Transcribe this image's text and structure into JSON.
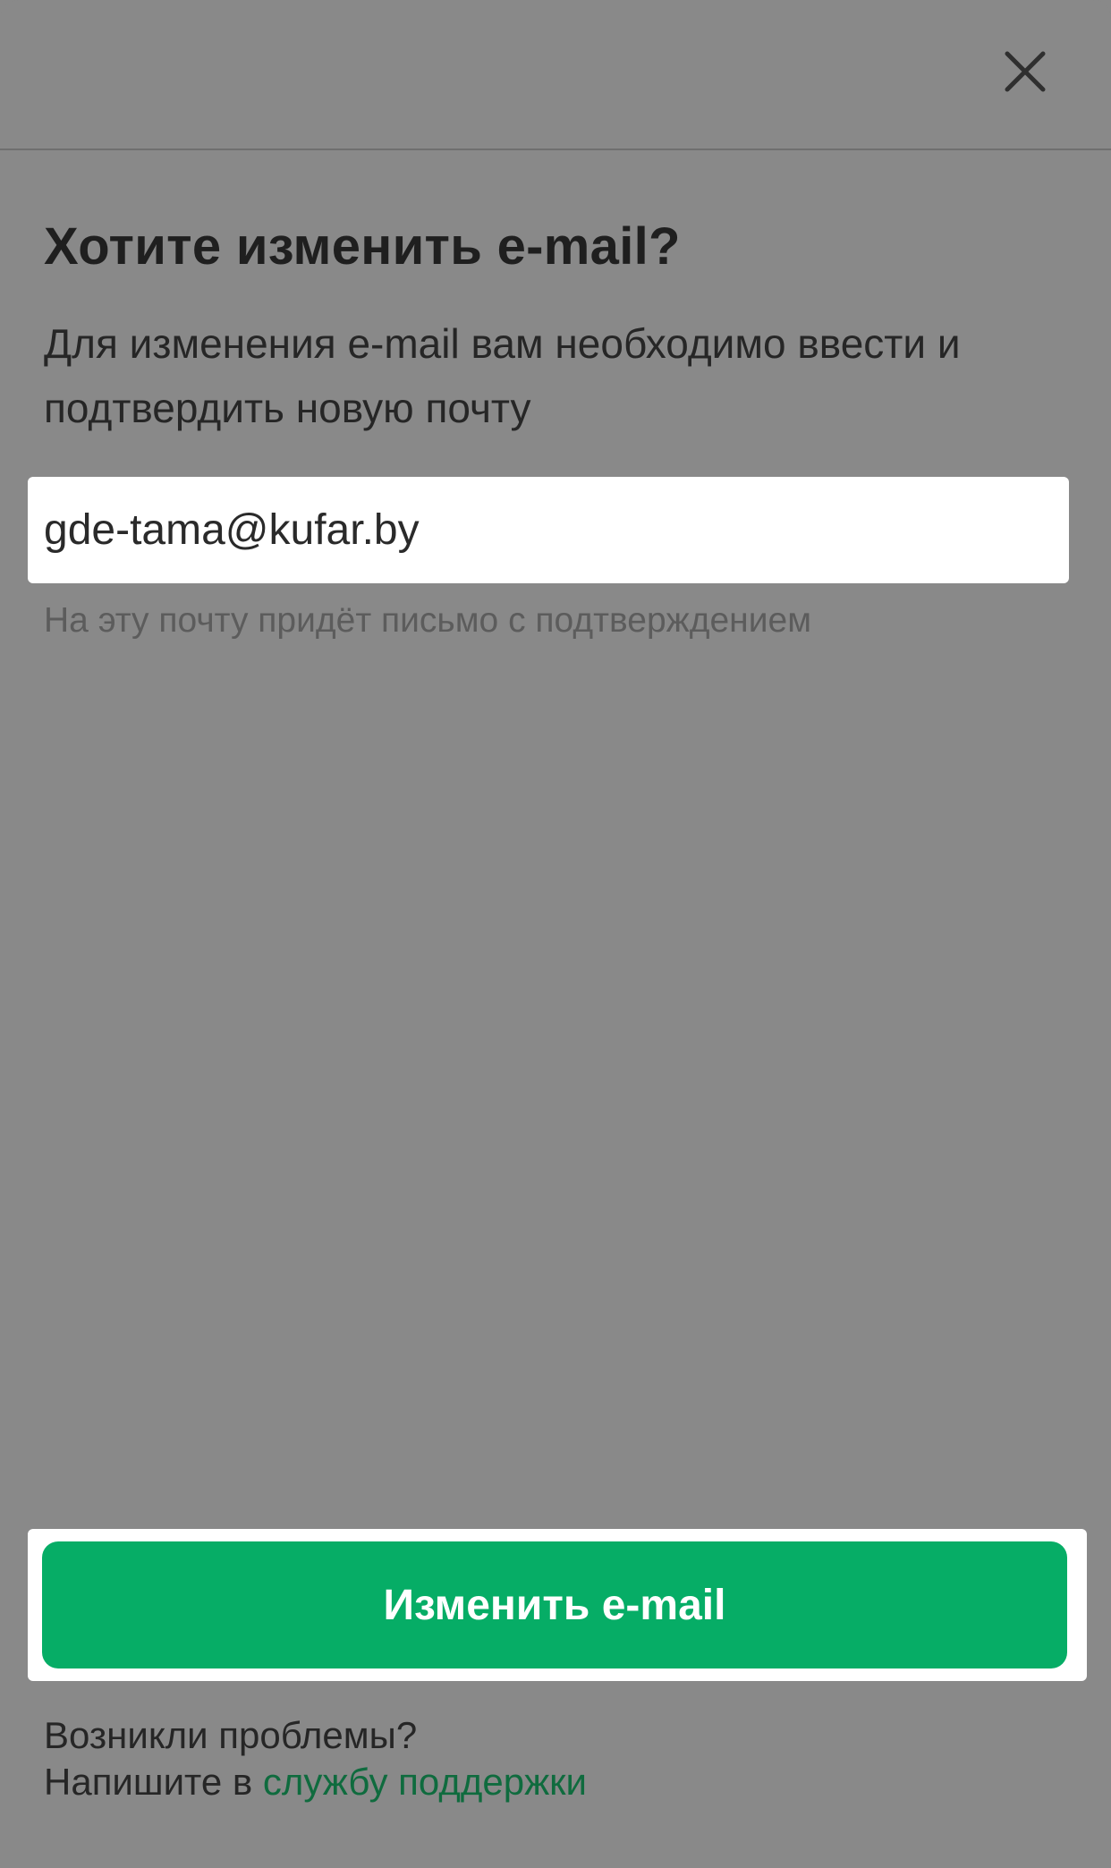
{
  "modal": {
    "title": "Хотите изменить e-mail?",
    "description": "Для изменения e-mail вам необходимо ввести и подтвердить новую почту",
    "email": {
      "value": "gde-tama@kufar.by"
    },
    "hint": "На эту почту придёт письмо с подтверждением",
    "submit_label": "Изменить e-mail",
    "footer": {
      "problem_text": "Возникли проблемы?",
      "write_prefix": "Напишите в",
      "support_link": "службу поддержки"
    }
  },
  "icons": {
    "close": "close-icon"
  },
  "colors": {
    "overlay": "#898989",
    "accent": "#06ad66",
    "link": "#0f6b3e"
  }
}
